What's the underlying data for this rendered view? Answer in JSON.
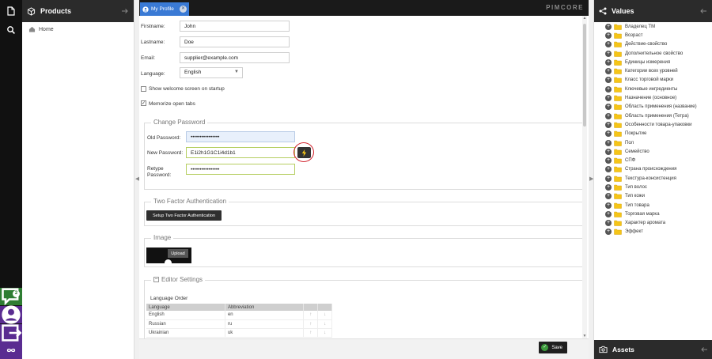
{
  "colors": {
    "tab_active": "#3a7ad5",
    "save_green": "#3c9a3c",
    "nav_purple": "#5a2c91",
    "chat_green": "#2e7d32",
    "generate_yellow": "#f5c518",
    "annotation_red": "#d1222c"
  },
  "rail": {
    "top_icons": [
      "document-icon",
      "search-icon"
    ],
    "chat_badge": "2",
    "bottom_icons": [
      "chat-icon",
      "user-icon",
      "export-icon",
      "infinity-icon"
    ]
  },
  "products_panel": {
    "title": "Products",
    "tree": [
      {
        "label": "Home",
        "icon": "home-icon"
      }
    ]
  },
  "tabs": [
    {
      "label": "My Profile",
      "icon": "user-icon"
    }
  ],
  "brand": "PIMCORE",
  "profile": {
    "firstname_label": "Firstname:",
    "firstname": "John",
    "lastname_label": "Lastname:",
    "lastname": "Doe",
    "email_label": "Email:",
    "email": "supplier@example.com",
    "language_label": "Language:",
    "language": "English",
    "welcome_label": "Show welcome screen on startup",
    "welcome_checked": false,
    "memorize_label": "Memorize open tabs",
    "memorize_checked": true
  },
  "password": {
    "legend": "Change Password",
    "old_label": "Old Password:",
    "old_value": "••••••••••••••••",
    "new_label": "New Password:",
    "new_value": "E1i2h1G1C1i4d1b1",
    "retype_label_1": "Retype",
    "retype_label_2": "Password:",
    "retype_value": "••••••••••••••••"
  },
  "two_factor": {
    "legend": "Two Factor Authentication",
    "button": "Setup Two Factor Authentication"
  },
  "image": {
    "legend": "Image",
    "upload": "Upload"
  },
  "editor": {
    "legend": "Editor Settings",
    "language_order": "Language Order",
    "headers": [
      "Language",
      "Abbreviation"
    ],
    "rows": [
      {
        "language": "English",
        "abbr": "en"
      },
      {
        "language": "Russian",
        "abbr": "ru"
      },
      {
        "language": "Ukrainian",
        "abbr": "uk"
      }
    ]
  },
  "save_label": "Save",
  "values_panel": {
    "title": "Values",
    "items": [
      "Владелец ТМ",
      "Возраст",
      "Действие-свойство",
      "Дополнительное свойство",
      "Единицы измерения",
      "Категории всех уровней",
      "Класс торговой марки",
      "Ключевые ингредиенты",
      "Назначение (основное)",
      "Область применения (название)",
      "Область применения (Тетра)",
      "Особенности товара-упаковки",
      "Покрытие",
      "Пол",
      "Семейство",
      "СПФ",
      "Страна происхождения",
      "Текстура-консистенция",
      "Тип волос",
      "Тип кожи",
      "Тип товара",
      "Торговая марка",
      "Характер аромата",
      "Эффект"
    ]
  },
  "assets_panel": {
    "title": "Assets"
  }
}
